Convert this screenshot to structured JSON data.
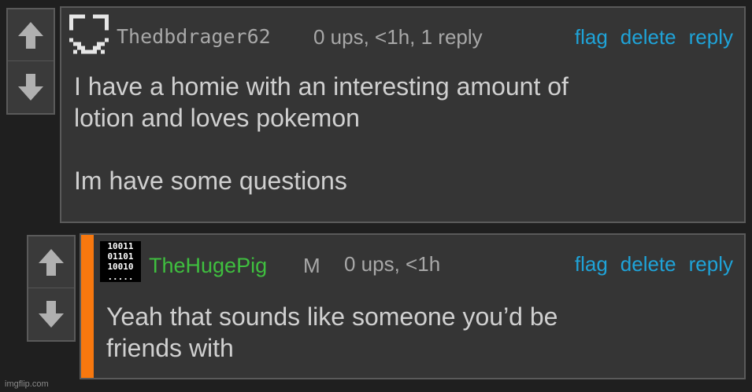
{
  "comments": [
    {
      "username": "Thedbdrager62",
      "mod_badge": "",
      "meta": "0 ups, <1h, 1 reply",
      "actions": [
        "flag",
        "delete",
        "reply"
      ],
      "text": "I have a homie with an interesting amount of\nlotion and loves pokemon\n\nIm have some questions",
      "avatar_icon": "pixel-face-icon"
    },
    {
      "username": "TheHugePig",
      "mod_badge": "M",
      "meta": "0 ups, <1h",
      "actions": [
        "flag",
        "delete",
        "reply"
      ],
      "text": "Yeah that sounds like someone you’d be\nfriends with",
      "avatar_icon": "binary-code-icon",
      "avatar_text": [
        "10011",
        "01101",
        "10010",
        "....."
      ]
    }
  ],
  "colors": {
    "link": "#1fa3d8",
    "reply_accent": "#f7780f",
    "username_default": "#a8a8a8",
    "username_op": "#3fbf3f"
  },
  "watermark": "imgflip.com"
}
